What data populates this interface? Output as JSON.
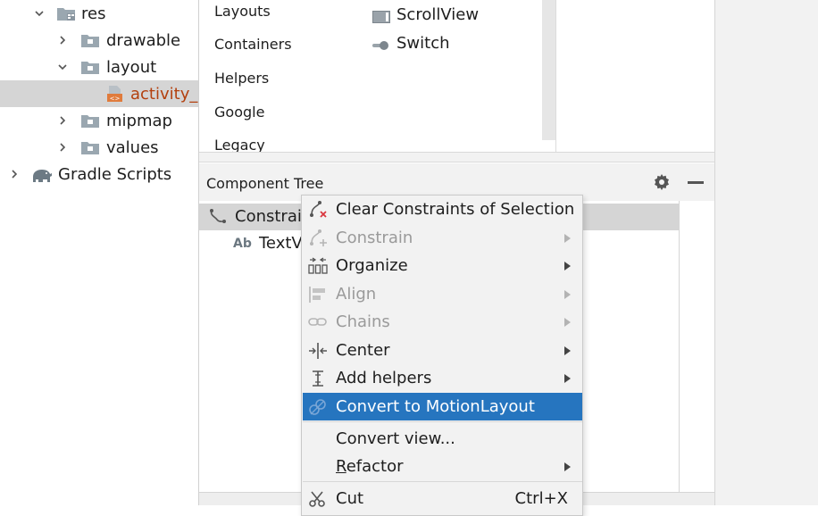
{
  "project_tree": {
    "items": [
      {
        "label": "res",
        "expanded": true,
        "icon": "folder-res-icon"
      },
      {
        "label": "drawable",
        "expanded": false,
        "icon": "folder-icon"
      },
      {
        "label": "layout",
        "expanded": true,
        "icon": "folder-icon"
      },
      {
        "label": "activity_m",
        "selected": true,
        "icon": "layout-xml-file-icon"
      },
      {
        "label": "mipmap",
        "expanded": false,
        "icon": "folder-icon"
      },
      {
        "label": "values",
        "expanded": false,
        "icon": "folder-icon"
      },
      {
        "label": "Gradle Scripts",
        "expanded": false,
        "icon": "gradle-elephant-icon"
      }
    ]
  },
  "palette": {
    "categories": [
      "Layouts",
      "Containers",
      "Helpers",
      "Google",
      "Legacy"
    ],
    "widgets": [
      {
        "label": "ScrollView",
        "icon": "scrollview-icon"
      },
      {
        "label": "Switch",
        "icon": "switch-icon"
      }
    ]
  },
  "component_tree": {
    "title": "Component Tree",
    "rows": [
      {
        "label": "Constrai",
        "icon": "constraint-layout-icon",
        "selected": true
      },
      {
        "label": "TextV",
        "icon_text": "Ab"
      }
    ]
  },
  "context_menu": {
    "items": [
      {
        "label": "Clear Constraints of Selection",
        "icon": "clear-constraints-icon",
        "enabled": true,
        "submenu": false
      },
      {
        "label": "Constrain",
        "icon": "constrain-icon",
        "enabled": false,
        "submenu": true
      },
      {
        "label": "Organize",
        "icon": "organize-icon",
        "enabled": true,
        "submenu": true
      },
      {
        "label": "Align",
        "icon": "align-icon",
        "enabled": false,
        "submenu": true
      },
      {
        "label": "Chains",
        "icon": "chains-icon",
        "enabled": false,
        "submenu": true
      },
      {
        "label": "Center",
        "icon": "center-icon",
        "enabled": true,
        "submenu": true
      },
      {
        "label": "Add helpers",
        "icon": "add-helpers-icon",
        "enabled": true,
        "submenu": true
      },
      {
        "label": "Convert to MotionLayout",
        "icon": "motionlayout-icon",
        "enabled": true,
        "submenu": false,
        "highlighted": true
      },
      {
        "label": "Convert view...",
        "enabled": true,
        "submenu": false
      },
      {
        "label_mnemonic": "R",
        "label_rest": "efactor",
        "enabled": true,
        "submenu": true
      },
      {
        "label": "Cut",
        "icon": "cut-icon",
        "shortcut": "Ctrl+X",
        "enabled": true,
        "submenu": false
      }
    ]
  },
  "colors": {
    "highlight": "#2675bf",
    "selected_row": "#d5d5d5",
    "file_label": "#b3400e",
    "disabled_text": "#9a9a9a"
  }
}
